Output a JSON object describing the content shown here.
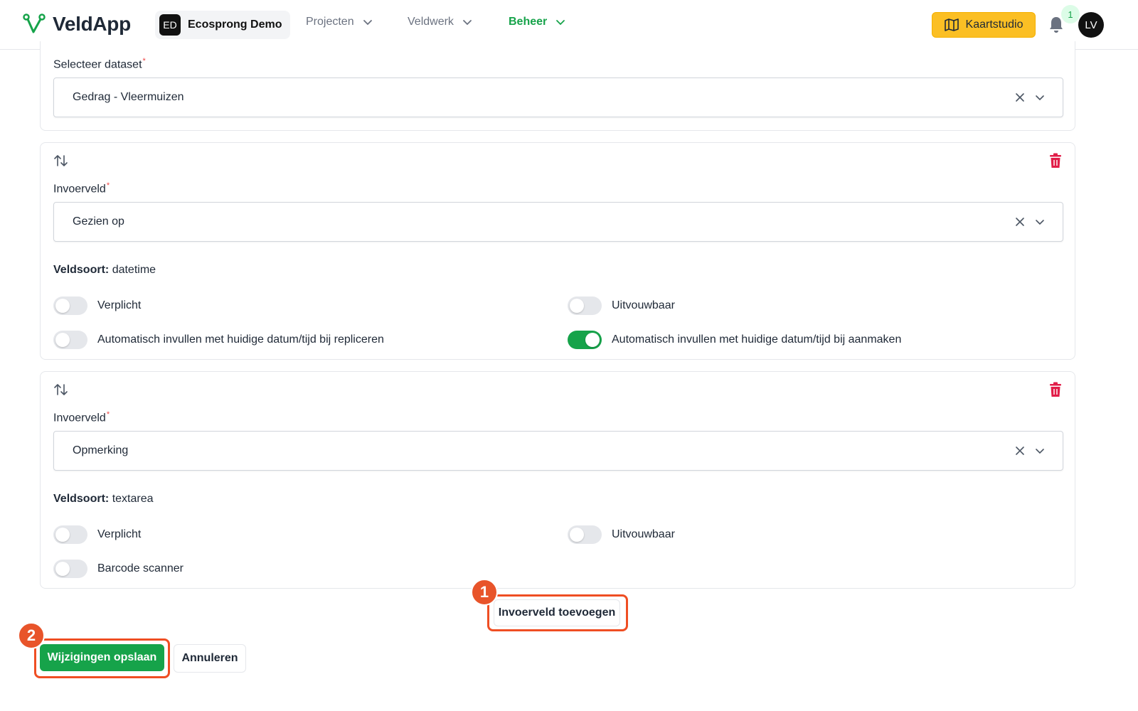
{
  "app": {
    "name": "VeldApp"
  },
  "org": {
    "initials": "ED",
    "name": "Ecosprong Demo"
  },
  "nav": [
    {
      "label": "Projecten"
    },
    {
      "label": "Veldwerk"
    },
    {
      "label": "Beheer",
      "active": true
    }
  ],
  "header": {
    "kaartstudio_label": "Kaartstudio",
    "notification_count": "1",
    "avatar_initials": "LV"
  },
  "colors": {
    "brand_green": "#16a34a",
    "accent_yellow": "#fbbf24",
    "danger_red": "#e11d48",
    "highlight_orange": "#ef4e23"
  },
  "dataset": {
    "label": "Selecteer dataset",
    "required_mark": "*",
    "value": "Gedrag - Vleermuizen"
  },
  "fields": [
    {
      "label": "Invoerveld",
      "required_mark": "*",
      "value": "Gezien op",
      "veldsoort_label": "Veldsoort:",
      "veldsoort_value": "datetime",
      "toggles": [
        {
          "label": "Verplicht",
          "on": false
        },
        {
          "label": "Uitvouwbaar",
          "on": false
        },
        {
          "label": "Automatisch invullen met huidige datum/tijd bij repliceren",
          "on": false
        },
        {
          "label": "Automatisch invullen met huidige datum/tijd bij aanmaken",
          "on": true
        }
      ]
    },
    {
      "label": "Invoerveld",
      "required_mark": "*",
      "value": "Opmerking",
      "veldsoort_label": "Veldsoort:",
      "veldsoort_value": "textarea",
      "toggles": [
        {
          "label": "Verplicht",
          "on": false
        },
        {
          "label": "Uitvouwbaar",
          "on": false
        },
        {
          "label": "Barcode scanner",
          "on": false
        }
      ]
    }
  ],
  "actions": {
    "add_field_label": "Invoerveld toevoegen",
    "save_label": "Wijzigingen opslaan",
    "cancel_label": "Annuleren"
  },
  "annotations": {
    "step1": "1",
    "step2": "2"
  }
}
